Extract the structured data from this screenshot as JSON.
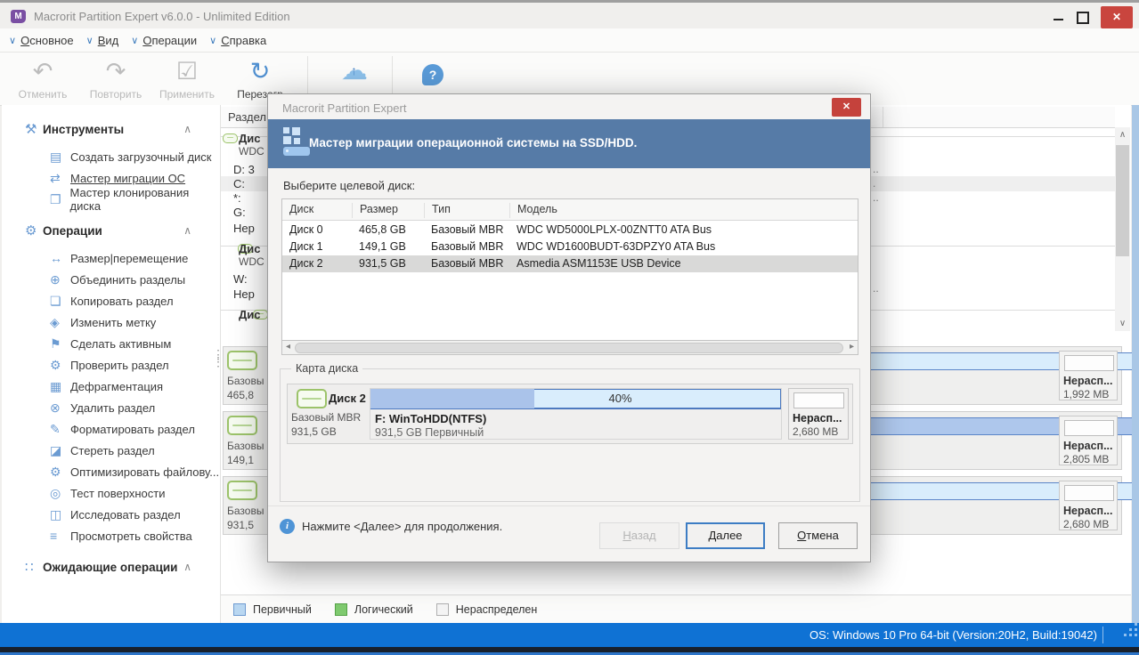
{
  "window": {
    "title": "Macrorit Partition Expert v6.0.0 - Unlimited Edition",
    "os_status": "OS: Windows 10 Pro 64-bit (Version:20H2, Build:19042)"
  },
  "menu": [
    "Основное",
    "Вид",
    "Операции",
    "Справка"
  ],
  "toolbar": [
    {
      "label": "Отменить",
      "icon": "undo-icon",
      "enabled": false
    },
    {
      "label": "Повторить",
      "icon": "redo-icon",
      "enabled": false
    },
    {
      "label": "Применить",
      "icon": "apply-check-icon",
      "enabled": false
    },
    {
      "label": "Перезагр",
      "icon": "reload-icon",
      "enabled": true
    },
    {
      "label": "",
      "icon": "cloud-upload-icon",
      "enabled": true
    },
    {
      "label": "",
      "icon": "help-bubble-icon",
      "enabled": true
    }
  ],
  "sidebar": {
    "sections": [
      {
        "title": "Инструменты",
        "icon": "tools-icon",
        "items": [
          {
            "label": "Создать загрузочный диск",
            "icon": "boot-disk-icon",
            "active": false
          },
          {
            "label": "Мастер миграции ОС",
            "icon": "migrate-os-icon",
            "active": true
          },
          {
            "label": "Мастер клонирования диска",
            "icon": "clone-disk-icon",
            "active": false
          }
        ]
      },
      {
        "title": "Операции",
        "icon": "operations-gear-icon",
        "items": [
          {
            "label": "Размер|перемещение",
            "icon": "resize-icon",
            "active": false
          },
          {
            "label": "Объединить разделы",
            "icon": "merge-icon",
            "active": false
          },
          {
            "label": "Копировать раздел",
            "icon": "copy-icon",
            "active": false
          },
          {
            "label": "Изменить метку",
            "icon": "label-tag-icon",
            "active": false
          },
          {
            "label": "Сделать активным",
            "icon": "flag-icon",
            "active": false
          },
          {
            "label": "Проверить раздел",
            "icon": "wrench-icon",
            "active": false
          },
          {
            "label": "Дефрагментация",
            "icon": "defrag-icon",
            "active": false
          },
          {
            "label": "Удалить раздел",
            "icon": "delete-icon",
            "active": false
          },
          {
            "label": "Форматировать раздел",
            "icon": "format-brush-icon",
            "active": false
          },
          {
            "label": "Стереть раздел",
            "icon": "erase-icon",
            "active": false
          },
          {
            "label": "Оптимизировать файлову...",
            "icon": "optimize-gear-icon",
            "active": false
          },
          {
            "label": "Тест поверхности",
            "icon": "surface-test-icon",
            "active": false
          },
          {
            "label": "Исследовать раздел",
            "icon": "explore-icon",
            "active": false
          },
          {
            "label": "Просмотреть свойства",
            "icon": "properties-icon",
            "active": false
          }
        ]
      },
      {
        "title": "Ожидающие операции",
        "icon": "pending-ops-icon",
        "items": []
      }
    ]
  },
  "background": {
    "partition_column_header": "Раздел",
    "row_fragments": [
      "Дис",
      "WDC",
      "D: 3",
      "C:",
      "*:",
      "G:",
      "Нер",
      "Дис",
      "WDC",
      "W:",
      "Нер",
      "Дис"
    ],
    "right_fragments": [
      "..",
      ".",
      "..",
      ".."
    ],
    "disk_map_rows": [
      {
        "type": "Базовы",
        "size": "465,8",
        "unalloc_label": "Нерасп...",
        "unalloc_size": "1,992 MB",
        "fill_pct": 0
      },
      {
        "type": "Базовы",
        "size": "149,1",
        "unalloc_label": "Нерасп...",
        "unalloc_size": "2,805 MB",
        "fill_pct": 89
      },
      {
        "type": "Базовы",
        "size": "931,5",
        "unalloc_label": "Нерасп...",
        "unalloc_size": "2,680 MB",
        "fill_pct": 0
      }
    ]
  },
  "legend": [
    {
      "label": "Первичный",
      "color": "#b9d7f1",
      "border": "#6f9bd1"
    },
    {
      "label": "Логический",
      "color": "#7fca6f",
      "border": "#55a348"
    },
    {
      "label": "Нераспределен",
      "color": "#f4f4f4",
      "border": "#b0b0b0"
    }
  ],
  "dialog": {
    "title": "Macrorit Partition Expert",
    "banner": "Мастер миграции операционной системы на SSD/HDD.",
    "select_label": "Выберите целевой диск:",
    "table": {
      "columns": [
        "Диск",
        "Размер",
        "Тип",
        "Модель"
      ],
      "rows": [
        [
          "Диск 0",
          "465,8 GB",
          "Базовый MBR",
          "WDC WD5000LPLX-00ZNTT0 ATA Bus"
        ],
        [
          "Диск 1",
          "149,1 GB",
          "Базовый MBR",
          "WDC WD1600BUDT-63DPZY0 ATA Bus"
        ],
        [
          "Диск 2",
          "931,5 GB",
          "Базовый MBR",
          "Asmedia ASM1153E USB Device"
        ]
      ],
      "selected_index": 2
    },
    "disk_map": {
      "group_title": "Карта диска",
      "disk_name": "Диск 2",
      "disk_type": "Базовый MBR",
      "disk_size": "931,5 GB",
      "partition_label": "F: WinToHDD(NTFS)",
      "partition_desc": "931,5 GB Первичный",
      "progress_pct": 40,
      "progress_text": "40%",
      "unalloc_label": "Нерасп...",
      "unalloc_size": "2,680 MB"
    },
    "hint": "Нажмите <Далее> для продолжения.",
    "buttons": {
      "back": "Назад",
      "next": "Далее",
      "cancel": "Отмена"
    }
  },
  "colors": {
    "banner_blue": "#567ba7",
    "statusbar_blue": "#0f72d4",
    "close_red": "#c9453e",
    "partition_fill": "#aac3ea",
    "partition_light": "#d9edfc",
    "partition_border": "#4d79bf"
  }
}
